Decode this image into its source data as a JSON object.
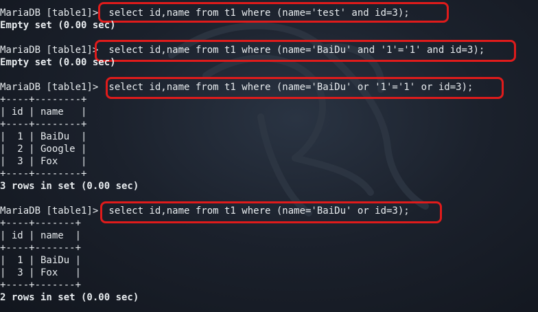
{
  "terminal": {
    "prompt": "MariaDB [table1]>",
    "blocks": [
      {
        "command": " select id,name from t1 where (name='test' and id=3);",
        "result": [
          "Empty set (0.00 sec)"
        ]
      },
      {
        "command": " select id,name from t1 where (name='BaiDu' and '1'='1' and id=3);",
        "result": [
          "Empty set (0.00 sec)"
        ]
      },
      {
        "command": " select id,name from t1 where (name='BaiDu' or '1'='1' or id=3);",
        "table": [
          "+----+--------+",
          "| id | name   |",
          "+----+--------+",
          "|  1 | BaiDu  |",
          "|  2 | Google |",
          "|  3 | Fox    |",
          "+----+--------+"
        ],
        "result": [
          "3 rows in set (0.00 sec)"
        ]
      },
      {
        "command": " select id,name from t1 where (name='BaiDu' or id=3);",
        "table": [
          "+----+-------+",
          "| id | name  |",
          "+----+-------+",
          "|  1 | BaiDu |",
          "|  3 | Fox   |",
          "+----+-------+"
        ],
        "result": [
          "2 rows in set (0.00 sec)"
        ]
      }
    ]
  },
  "colors": {
    "background": "#1b212c",
    "text": "#e8ecef",
    "highlight": "#e01b1b"
  }
}
